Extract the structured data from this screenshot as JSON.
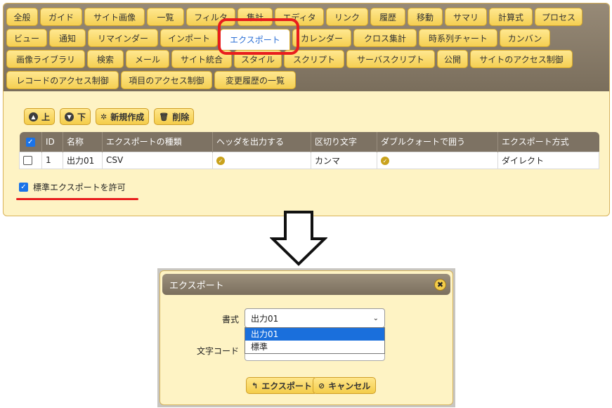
{
  "tabs": {
    "row1": [
      "全般",
      "ガイド",
      "サイト画像",
      "一覧",
      "フィルタ",
      "集計",
      "エディタ",
      "リンク",
      "履歴",
      "移動",
      "サマリ",
      "計算式",
      "プロセス"
    ],
    "row2": [
      "ビュー",
      "通知",
      "リマインダー",
      "インポート",
      "エクスポート",
      "カレンダー",
      "クロス集計",
      "時系列チャート",
      "カンバン"
    ],
    "row3": [
      "画像ライブラリ",
      "検索",
      "メール",
      "サイト統合",
      "スタイル",
      "スクリプト",
      "サーバスクリプト",
      "公開",
      "サイトのアクセス制御"
    ],
    "row4": [
      "レコードのアクセス制御",
      "項目のアクセス制御",
      "変更履歴の一覧"
    ],
    "active": "エクスポート"
  },
  "toolbar": {
    "up_label": "上",
    "down_label": "下",
    "new_label": "新規作成",
    "delete_label": "削除"
  },
  "table": {
    "headers": [
      "ID",
      "名称",
      "エクスポートの種類",
      "ヘッダを出力する",
      "区切り文字",
      "ダブルクォートで囲う",
      "エクスポート方式"
    ],
    "rows": [
      {
        "id": "1",
        "name": "出力01",
        "type": "CSV",
        "header": true,
        "delimiter": "カンマ",
        "quote": true,
        "method": "ダイレクト"
      }
    ]
  },
  "allow_standard": {
    "label": "標準エクスポートを許可",
    "checked": true
  },
  "dialog": {
    "title": "エクスポート",
    "format_label": "書式",
    "format_value": "出力01",
    "format_options": [
      "出力01",
      "標準"
    ],
    "encoding_label": "文字コード",
    "export_button": "エクスポート",
    "cancel_button": "キャンセル"
  },
  "colors": {
    "highlight": "#e81d1d",
    "tab_yellow": "#f5cf52",
    "header_brown": "#7d7263",
    "panel_bg": "#fef3c4"
  }
}
